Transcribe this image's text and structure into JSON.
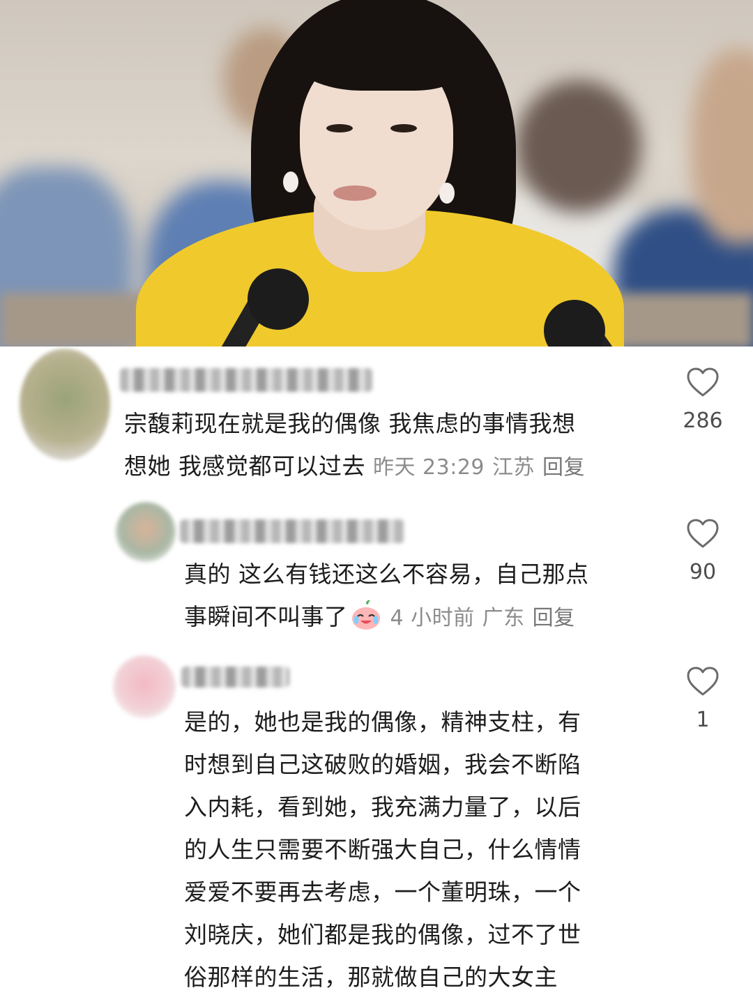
{
  "photo": {
    "description_icon": "photo-of-woman-in-yellow-at-meeting"
  },
  "comments": [
    {
      "text_line1": "宗馥莉现在就是我的偶像 我焦虑的事情我想",
      "text_line2": "想她 我感觉都可以过去",
      "time": "昨天 23:29",
      "location": "江苏",
      "reply_label": "回复",
      "likes": "286"
    },
    {
      "text_line1": "真的 这么有钱还这么不容易，自己那点",
      "text_line2": "事瞬间不叫事了",
      "emoji": "crying-laughing-peach-emoji",
      "time": "4 小时前",
      "location": "广东",
      "reply_label": "回复",
      "likes": "90"
    },
    {
      "lines": [
        "是的，她也是我的偶像，精神支柱，有",
        "时想到自己这破败的婚姻，我会不断陷",
        "入内耗，看到她，我充满力量了，以后",
        "的人生只需要不断强大自己，什么情情",
        "爱爱不要再去考虑，一个董明珠，一个",
        "刘晓庆，她们都是我的偶像，过不了世",
        "俗那样的生活，那就做自己的大女主"
      ],
      "likes": "1"
    }
  ],
  "colors": {
    "text": "#1d1d1d",
    "meta": "#8c8c8c",
    "like_count": "#4d4d4d",
    "heart_outline": "#6b6b6b"
  }
}
